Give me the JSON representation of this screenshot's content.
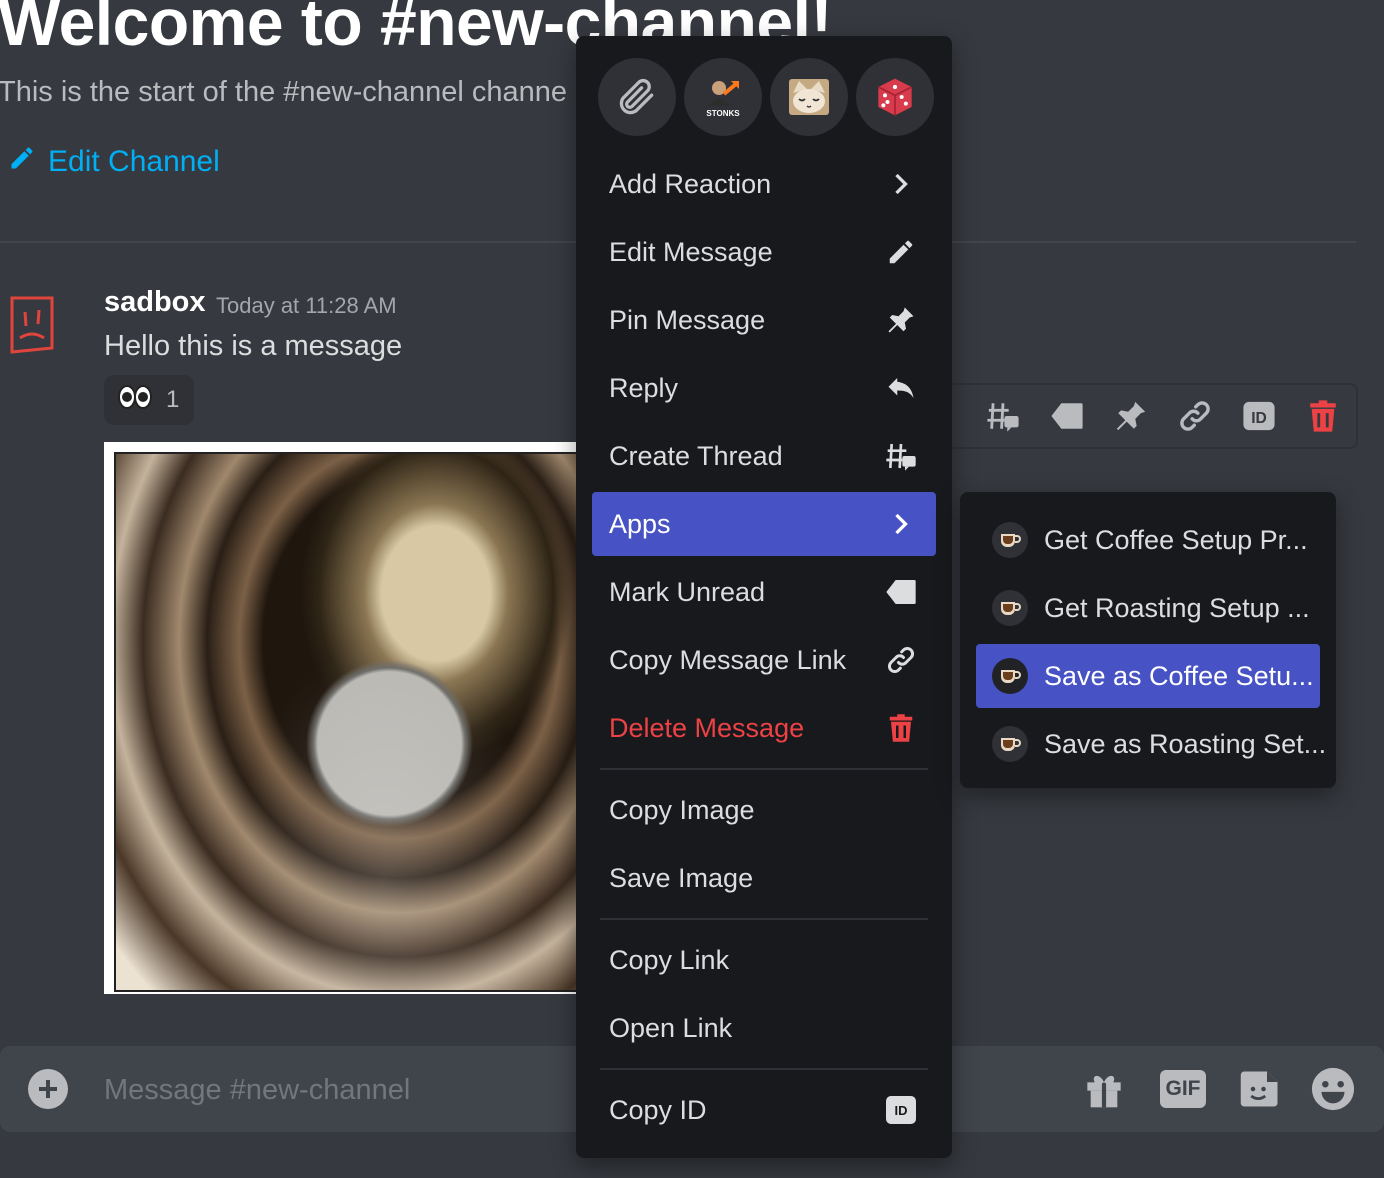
{
  "channel": {
    "welcome_title": "Welcome to #new-channel!",
    "welcome_subtitle": "This is the start of the #new-channel channe",
    "edit_channel_label": "Edit Channel"
  },
  "message": {
    "author": "sadbox",
    "timestamp": "Today at 11:28 AM",
    "text": "Hello this is a message",
    "reaction": {
      "emoji": "👀",
      "count": "1"
    }
  },
  "toolbar": {
    "icons": [
      "create-thread-icon",
      "mark-unread-icon",
      "pin-icon",
      "copy-link-icon",
      "copy-id-icon",
      "delete-icon"
    ]
  },
  "composer": {
    "placeholder": "Message #new-channel",
    "gif_label": "GIF"
  },
  "context_menu": {
    "quick_reactions": [
      "paperclip",
      "stonks",
      "cat",
      "game_die"
    ],
    "stonks_text": "STONKS",
    "items": [
      {
        "label": "Add Reaction",
        "icon": "chevron-right-icon"
      },
      {
        "label": "Edit Message",
        "icon": "pencil-icon"
      },
      {
        "label": "Pin Message",
        "icon": "pin-icon"
      },
      {
        "label": "Reply",
        "icon": "reply-icon"
      },
      {
        "label": "Create Thread",
        "icon": "thread-icon"
      },
      {
        "label": "Apps",
        "icon": "chevron-right-icon"
      },
      {
        "label": "Mark Unread",
        "icon": "mark-unread-icon"
      },
      {
        "label": "Copy Message Link",
        "icon": "link-icon"
      },
      {
        "label": "Delete Message",
        "icon": "trash-icon"
      },
      {
        "label": "Copy Image",
        "icon": ""
      },
      {
        "label": "Save Image",
        "icon": ""
      },
      {
        "label": "Copy Link",
        "icon": ""
      },
      {
        "label": "Open Link",
        "icon": ""
      },
      {
        "label": "Copy ID",
        "icon": "id-icon"
      }
    ],
    "id_badge": "ID"
  },
  "apps_submenu": {
    "items": [
      {
        "label": "Get Coffee Setup Pr..."
      },
      {
        "label": "Get Roasting Setup ..."
      },
      {
        "label": "Save as Coffee Setu..."
      },
      {
        "label": "Save as Roasting Set..."
      }
    ]
  },
  "colors": {
    "background": "#36393f",
    "menu_bg": "#18191c",
    "accent": "#4752c4",
    "link": "#00aff4",
    "danger": "#ed4245"
  }
}
